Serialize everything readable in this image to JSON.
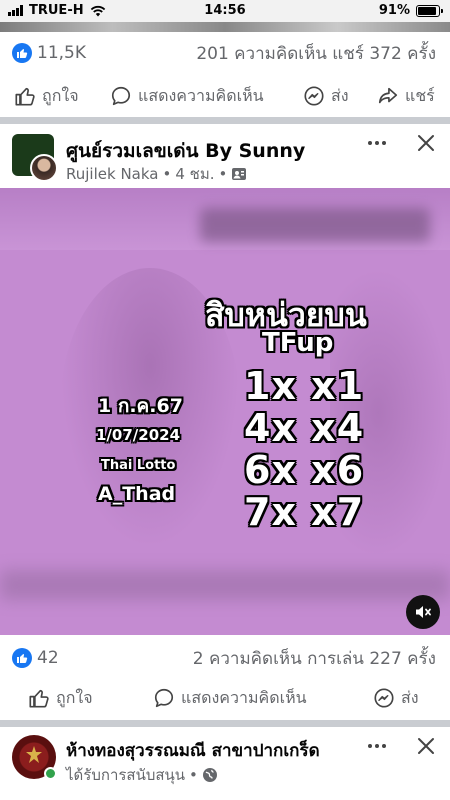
{
  "status_bar": {
    "carrier": "TRUE-H",
    "time": "14:56",
    "battery": "91%",
    "battery_level": 0.91
  },
  "post1": {
    "reaction_count": "11,5K",
    "comments_shares": "201 ความคิดเห็น แชร์ 372 ครั้ง",
    "actions": {
      "like": "ถูกใจ",
      "comment": "แสดงความคิดเห็น",
      "send": "ส่ง",
      "share": "แชร์"
    }
  },
  "post2": {
    "page_name": "ศูนย์รวมเลขเด่น By Sunny",
    "author": "Rujilek Naka",
    "time": "4 ชม.",
    "media": {
      "headline": "สิบหน่วยบน",
      "subheadline": "TFup",
      "date_thai": "1 ก.ค.67",
      "date": "1/07/2024",
      "lottery": "Thai Lotto",
      "author_tag": "A_Thad",
      "numbers": [
        "1x x1",
        "4x x4",
        "6x x6",
        "7x x7"
      ]
    },
    "reaction_count": "42",
    "comments_plays": "2 ความคิดเห็น การเล่น 227 ครั้ง",
    "actions": {
      "like": "ถูกใจ",
      "comment": "แสดงความคิดเห็น",
      "send": "ส่ง"
    }
  },
  "post3": {
    "page_name": "ห้างทองสุวรรณมณี สาขาปากเกร็ด",
    "sponsored": "ได้รับการสนับสนุน"
  },
  "colors": {
    "facebook_blue": "#1877f2",
    "media_bg": "#c48bd1",
    "gray_text": "#65676b"
  }
}
